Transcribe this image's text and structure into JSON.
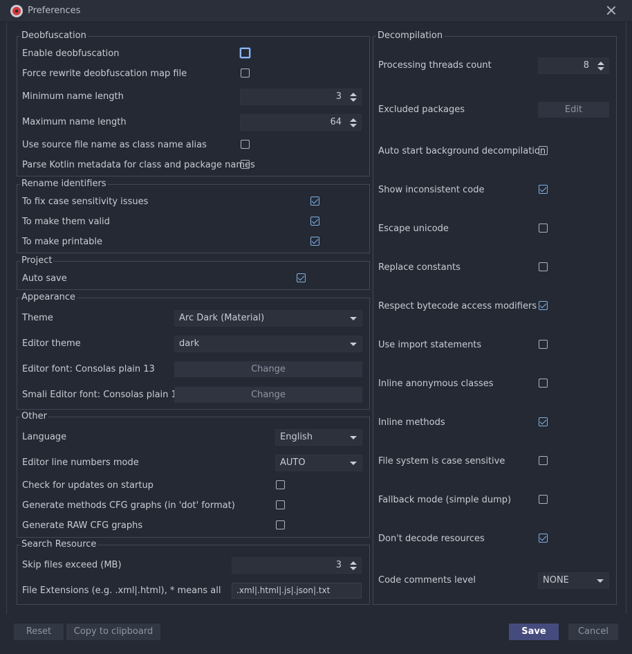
{
  "window": {
    "title": "Preferences"
  },
  "deobfuscation": {
    "title": "Deobfuscation",
    "enable_label": "Enable deobfuscation",
    "force_rewrite_label": "Force rewrite deobfuscation map file",
    "min_name_label": "Minimum name length",
    "min_name_value": "3",
    "max_name_label": "Maximum name length",
    "max_name_value": "64",
    "source_alias_label": "Use source file name as class name alias",
    "kotlin_label": "Parse Kotlin metadata for class and package names"
  },
  "rename": {
    "title": "Rename identifiers",
    "case_label": "To fix case sensitivity issues",
    "valid_label": "To make them valid",
    "printable_label": "To make printable"
  },
  "project": {
    "title": "Project",
    "auto_save_label": "Auto save"
  },
  "appearance": {
    "title": "Appearance",
    "theme_label": "Theme",
    "theme_value": "Arc Dark (Material)",
    "editor_theme_label": "Editor theme",
    "editor_theme_value": "dark",
    "editor_font_label": "Editor font: Consolas plain 13",
    "smali_font_label": "Smali Editor font: Consolas plain 13",
    "change_label": "Change"
  },
  "other": {
    "title": "Other",
    "language_label": "Language",
    "language_value": "English",
    "line_numbers_label": "Editor line numbers mode",
    "line_numbers_value": "AUTO",
    "updates_label": "Check for updates on startup",
    "cfg_label": "Generate methods CFG graphs (in 'dot' format)",
    "raw_cfg_label": "Generate RAW CFG graphs"
  },
  "search": {
    "title": "Search Resource",
    "skip_label": "Skip files exceed (MB)",
    "skip_value": "3",
    "ext_label": "File Extensions (e.g. .xml|.html), * means all",
    "ext_value": ".xml|.html|.js|.json|.txt"
  },
  "decompilation": {
    "title": "Decompilation",
    "threads_label": "Processing threads count",
    "threads_value": "8",
    "excluded_label": "Excluded packages",
    "edit_label": "Edit",
    "auto_start_label": "Auto start background decompilation",
    "inconsistent_label": "Show inconsistent code",
    "escape_label": "Escape unicode",
    "replace_label": "Replace constants",
    "respect_label": "Respect bytecode access modifiers",
    "import_label": "Use import statements",
    "anon_label": "Inline anonymous classes",
    "inline_methods_label": "Inline methods",
    "fs_case_label": "File system is case sensitive",
    "fallback_label": "Fallback mode (simple dump)",
    "no_decode_label": "Don't decode resources",
    "comments_label": "Code comments level",
    "comments_value": "NONE"
  },
  "footer": {
    "reset_label": "Reset",
    "copy_label": "Copy to clipboard",
    "save_label": "Save",
    "cancel_label": "Cancel"
  },
  "colors": {
    "background": "#252933",
    "accent_check": "#7fb2e6",
    "save_button": "#464b7e"
  }
}
